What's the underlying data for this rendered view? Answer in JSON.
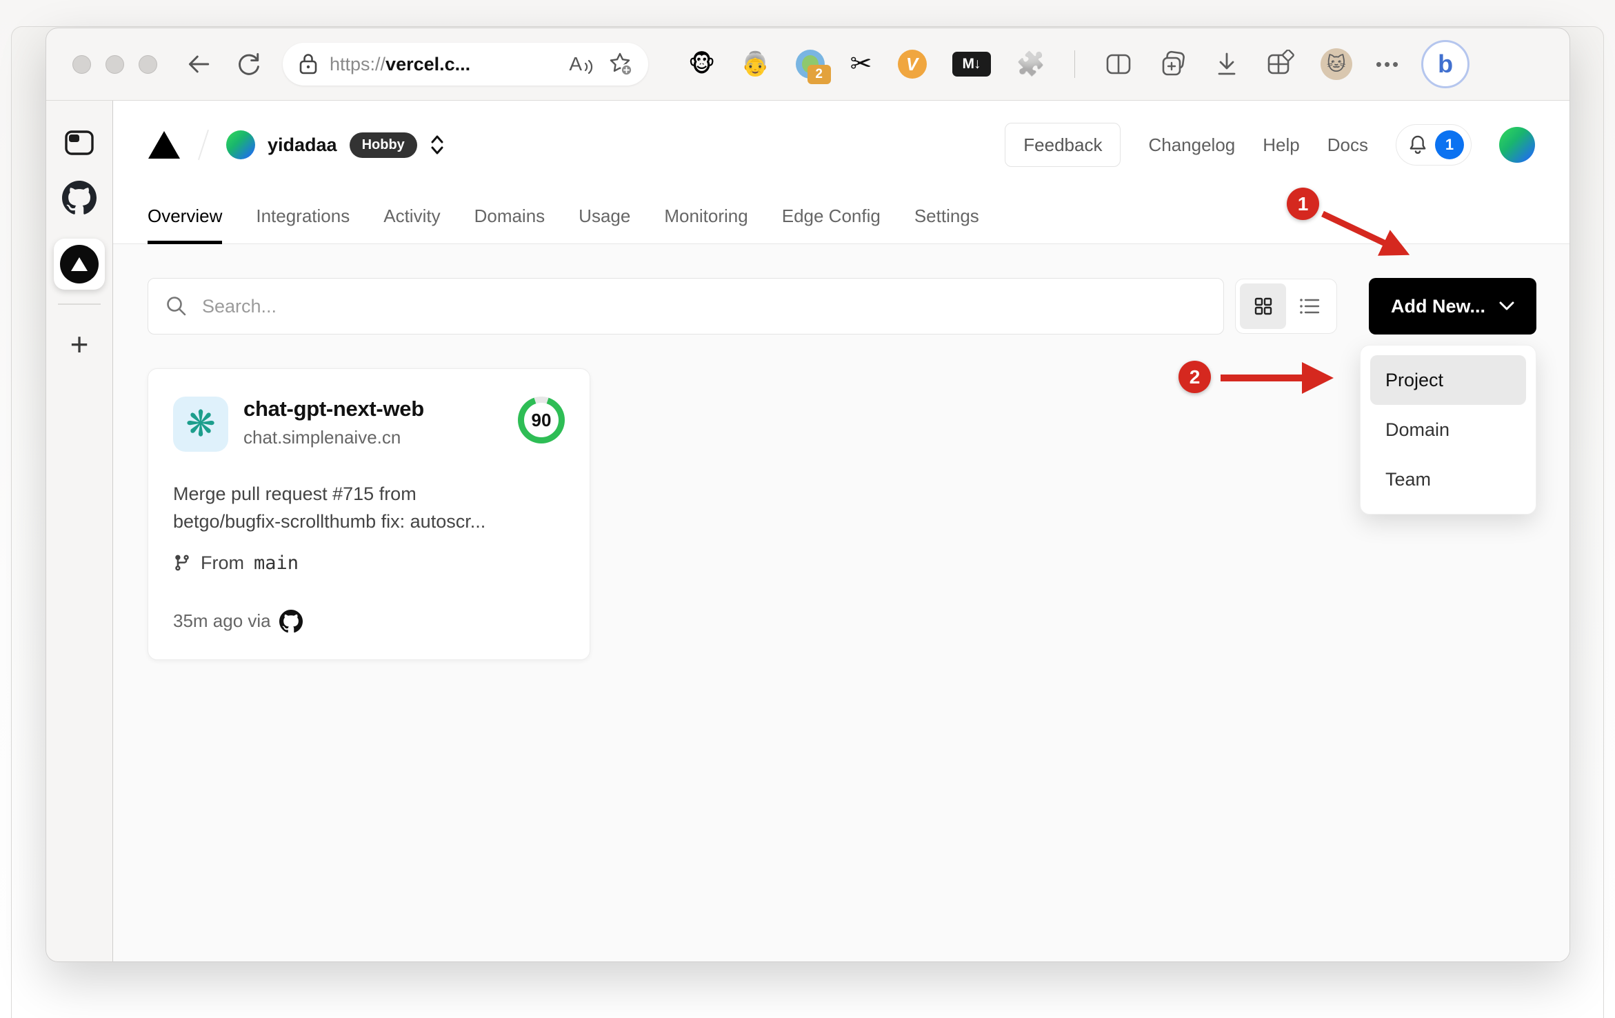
{
  "browser": {
    "url": {
      "scheme": "https://",
      "host": "vercel.c..."
    },
    "toolbar_icons": {
      "readaloud_glyph": "A",
      "monkey_glyph": "🐵",
      "grandma_glyph": "👵",
      "extension_badge": "2",
      "scissors_glyph": "✂",
      "vee_glyph": "V",
      "markdown_glyph": "M↓",
      "puzzle_glyph": "🧩",
      "cat_avatar_glyph": "🐱",
      "more_glyph": "•••",
      "bing_glyph": "b"
    },
    "sidebar": {
      "new_tab_glyph": "+"
    }
  },
  "vercel": {
    "team": {
      "name": "yidadaa",
      "plan": "Hobby"
    },
    "header": {
      "feedback": "Feedback",
      "links": [
        {
          "label": "Changelog"
        },
        {
          "label": "Help"
        },
        {
          "label": "Docs"
        }
      ],
      "notification_count": "1"
    },
    "tabs": [
      {
        "label": "Overview"
      },
      {
        "label": "Integrations"
      },
      {
        "label": "Activity"
      },
      {
        "label": "Domains"
      },
      {
        "label": "Usage"
      },
      {
        "label": "Monitoring"
      },
      {
        "label": "Edge Config"
      },
      {
        "label": "Settings"
      }
    ],
    "controls": {
      "search_placeholder": "Search...",
      "add_new": "Add New..."
    },
    "dropdown": {
      "items": [
        {
          "label": "Project"
        },
        {
          "label": "Domain"
        },
        {
          "label": "Team"
        }
      ]
    },
    "project": {
      "name": "chat-gpt-next-web",
      "domain": "chat.simplenaive.cn",
      "score": "90",
      "commit_line1": "Merge pull request #715 from",
      "commit_line2": "betgo/bugfix-scrollthumb fix: autoscr...",
      "branch_prefix": "From",
      "branch": "main",
      "deployed": "35m ago via"
    }
  },
  "annotations": {
    "step1": "1",
    "step2": "2"
  },
  "colors": {
    "score_green": "#2ebd55",
    "annotation_red": "#d5281f",
    "notification_blue": "#0b72f1",
    "add_new_black": "#000000",
    "plan_badge_dark": "#333333"
  }
}
